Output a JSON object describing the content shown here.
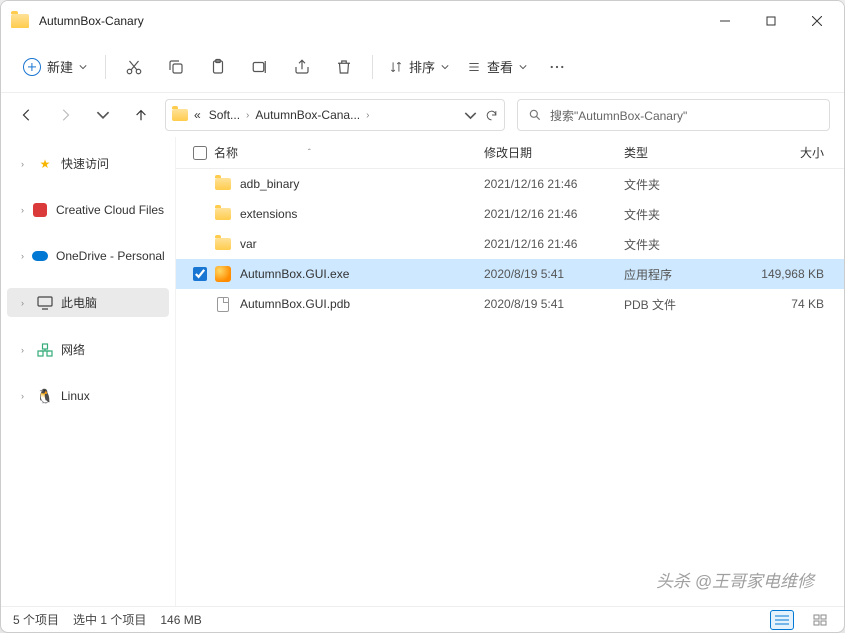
{
  "window": {
    "title": "AutumnBox-Canary"
  },
  "toolbar": {
    "new_label": "新建",
    "sort_label": "排序",
    "view_label": "查看"
  },
  "breadcrumbs": {
    "pre": "«",
    "items": [
      "Soft...",
      "AutumnBox-Cana..."
    ]
  },
  "search": {
    "placeholder": "搜索\"AutumnBox-Canary\""
  },
  "sidebar": {
    "items": [
      {
        "label": "快速访问",
        "icon": "star"
      },
      {
        "label": "Creative Cloud Files",
        "icon": "cc"
      },
      {
        "label": "OneDrive - Personal",
        "icon": "onedrive"
      },
      {
        "label": "此电脑",
        "icon": "pc",
        "active": true
      },
      {
        "label": "网络",
        "icon": "network"
      },
      {
        "label": "Linux",
        "icon": "linux"
      }
    ]
  },
  "columns": {
    "name": "名称",
    "date": "修改日期",
    "type": "类型",
    "size": "大小"
  },
  "files": [
    {
      "name": "adb_binary",
      "date": "2021/12/16 21:46",
      "type": "文件夹",
      "size": "",
      "icon": "folder"
    },
    {
      "name": "extensions",
      "date": "2021/12/16 21:46",
      "type": "文件夹",
      "size": "",
      "icon": "folder"
    },
    {
      "name": "var",
      "date": "2021/12/16 21:46",
      "type": "文件夹",
      "size": "",
      "icon": "folder"
    },
    {
      "name": "AutumnBox.GUI.exe",
      "date": "2020/8/19 5:41",
      "type": "应用程序",
      "size": "149,968 KB",
      "icon": "exe",
      "selected": true
    },
    {
      "name": "AutumnBox.GUI.pdb",
      "date": "2020/8/19 5:41",
      "type": "PDB 文件",
      "size": "74 KB",
      "icon": "doc"
    }
  ],
  "status": {
    "count": "5 个项目",
    "selected": "选中 1 个项目",
    "size": "146 MB"
  },
  "watermark": "头杀 @王哥家电维修"
}
